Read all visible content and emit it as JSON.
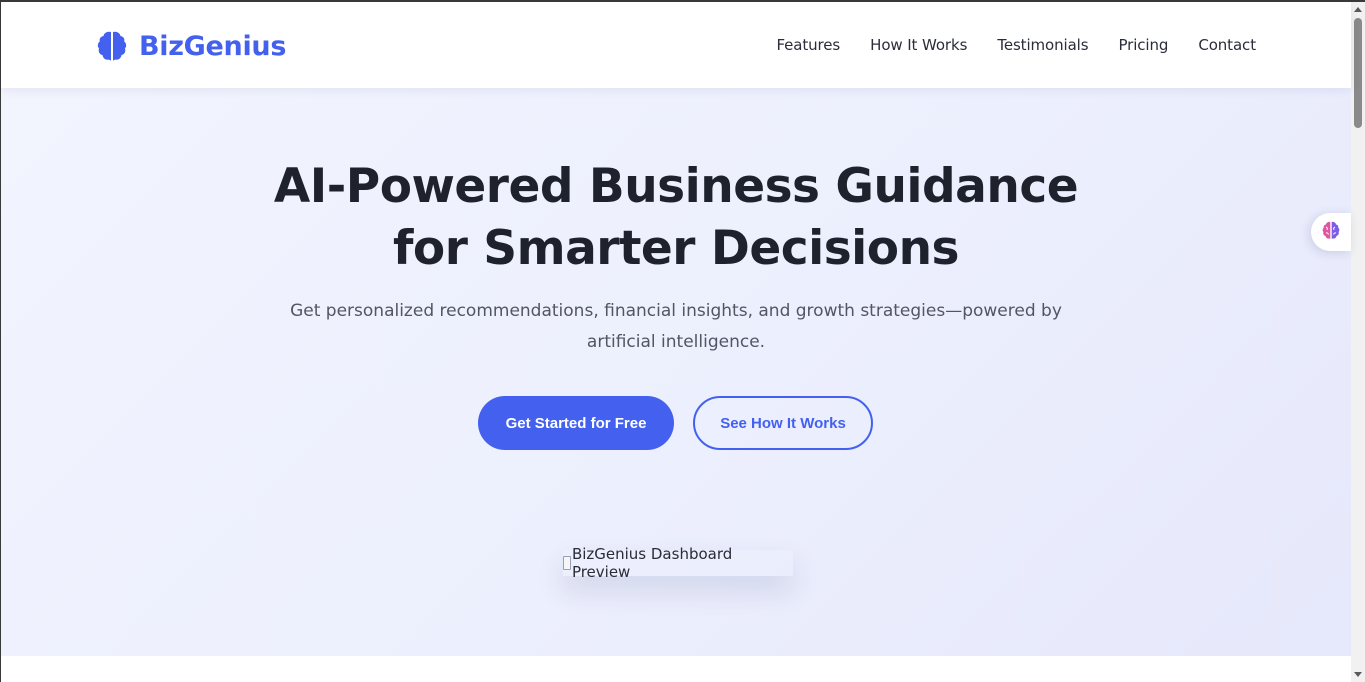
{
  "brand": {
    "name": "BizGenius",
    "icon": "brain-icon",
    "color": "#4361ee"
  },
  "nav": {
    "items": [
      "Features",
      "How It Works",
      "Testimonials",
      "Pricing",
      "Contact"
    ]
  },
  "hero": {
    "title_line1": "AI-Powered Business Guidance",
    "title_line2": "for Smarter Decisions",
    "subtitle": "Get personalized recommendations, financial insights, and growth strategies—powered by artificial intelligence.",
    "primary_button": "Get Started for Free",
    "secondary_button": "See How It Works",
    "preview_alt": "BizGenius Dashboard Preview"
  },
  "floating_widget": {
    "icon": "brain-icon"
  },
  "colors": {
    "accent": "#4361ee",
    "title": "#1e222c",
    "subtitle": "#525663"
  }
}
